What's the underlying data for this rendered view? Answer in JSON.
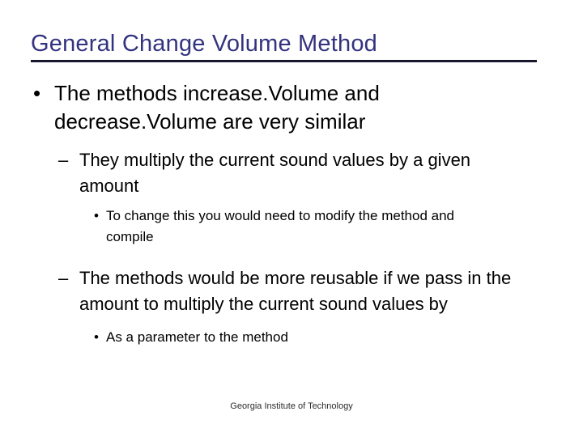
{
  "slide": {
    "title": "General Change Volume Method",
    "title_color": "#33337f",
    "rule_color": "#17172e",
    "background_color": "#ffffff",
    "body_text_color": "#000000",
    "footer": "Georgia Institute of Technology",
    "markers": {
      "level1": "•",
      "level2": "–",
      "level3": "•"
    },
    "bullets": [
      {
        "level": 1,
        "text": "The methods increase.Volume and decrease.Volume are very similar"
      },
      {
        "level": 2,
        "text": "They multiply the current sound values by a given amount"
      },
      {
        "level": 3,
        "text": "To change this you would need to modify the method and compile"
      },
      {
        "level": 2,
        "text": "The methods would be more reusable if we pass in the amount to multiply the current sound values by"
      },
      {
        "level": 3,
        "text": "As a parameter to the method"
      }
    ]
  }
}
